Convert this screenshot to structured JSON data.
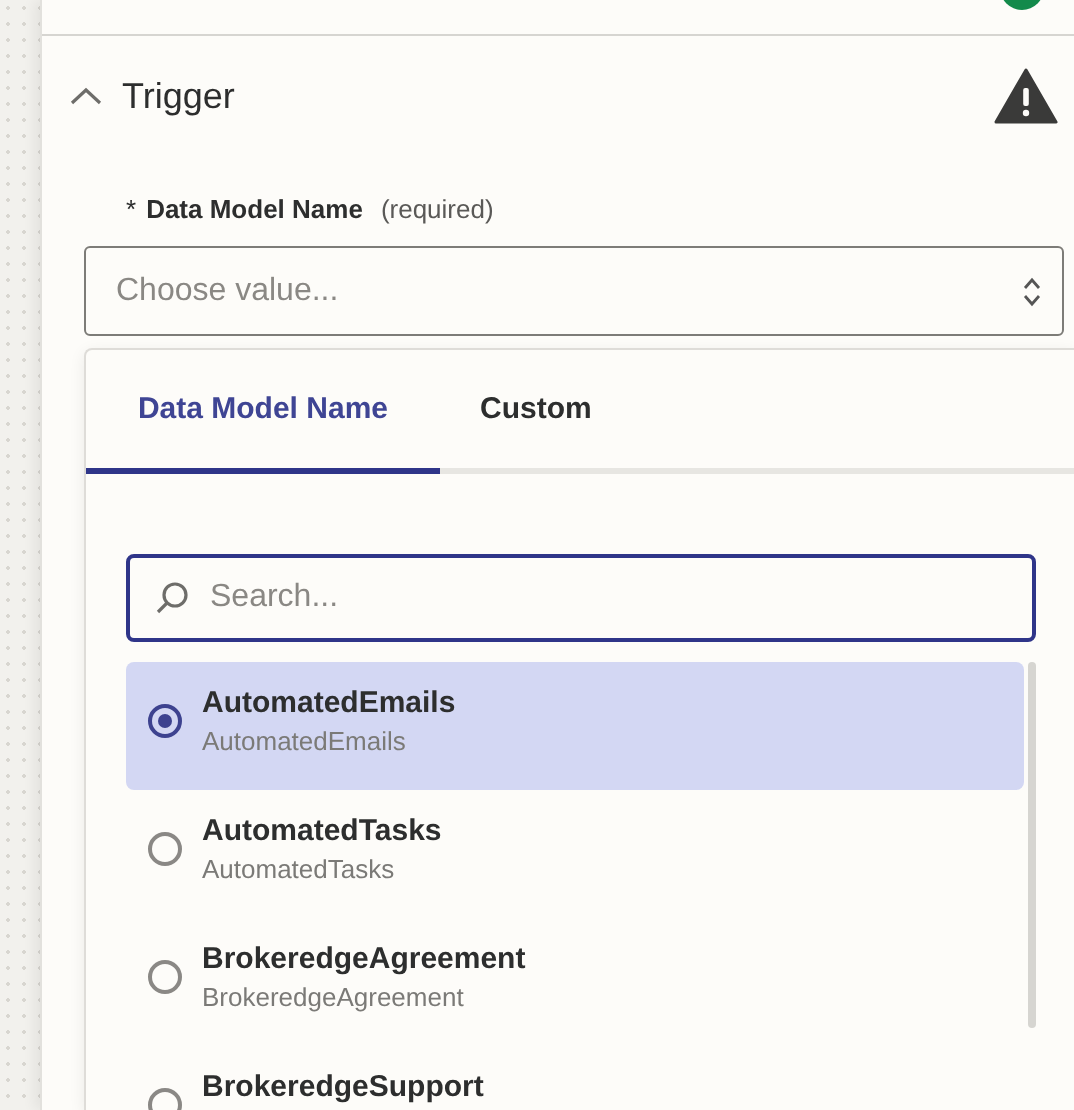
{
  "section": {
    "title": "Trigger",
    "expanded": true
  },
  "field": {
    "required_mark": "*",
    "label": "Data Model Name",
    "hint": "(required)",
    "placeholder": "Choose value..."
  },
  "dropdown": {
    "tabs": [
      {
        "label": "Data Model Name",
        "selected": true
      },
      {
        "label": "Custom",
        "selected": false
      }
    ],
    "search": {
      "placeholder": "Search..."
    },
    "options": [
      {
        "label": "AutomatedEmails",
        "sublabel": "AutomatedEmails",
        "selected": true
      },
      {
        "label": "AutomatedTasks",
        "sublabel": "AutomatedTasks",
        "selected": false
      },
      {
        "label": "BrokeredgeAgreement",
        "sublabel": "BrokeredgeAgreement",
        "selected": false
      },
      {
        "label": "BrokeredgeSupport",
        "selected": false
      }
    ]
  }
}
